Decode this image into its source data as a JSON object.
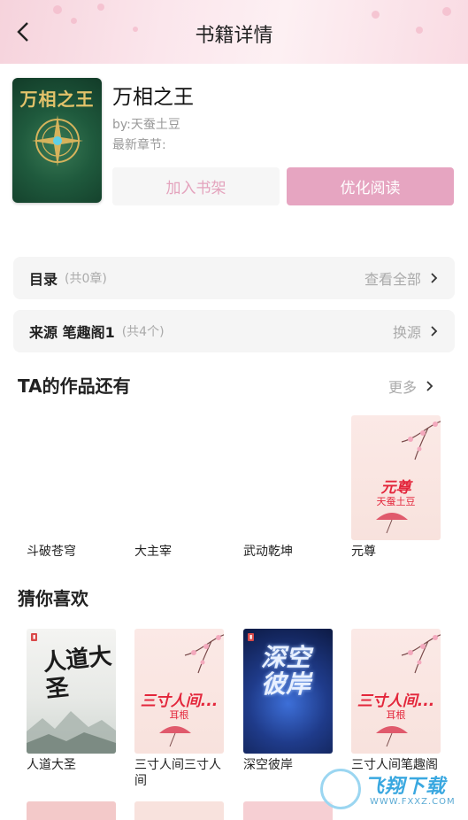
{
  "header": {
    "title": "书籍详情"
  },
  "book": {
    "title": "万相之王",
    "author": "by:天蚕土豆",
    "latest": "最新章节:",
    "cover_title": "万相之王",
    "shelf_label": "加入书架",
    "read_label": "优化阅读"
  },
  "catalog": {
    "label": "目录",
    "count": "(共0章)",
    "action": "查看全部"
  },
  "source": {
    "label": "来源 笔趣阁1",
    "count": "(共4个)",
    "action": "换源"
  },
  "author_works": {
    "title": "TA的作品还有",
    "more": "更多",
    "items": [
      {
        "name": "斗破苍穹"
      },
      {
        "name": "大主宰"
      },
      {
        "name": "武动乾坤"
      },
      {
        "name": "元尊",
        "cover_title": "元尊",
        "cover_sub": "天蚕土豆"
      }
    ]
  },
  "recommend": {
    "title": "猜你喜欢",
    "items": [
      {
        "name": "人道大圣",
        "cover_title": "人道大圣"
      },
      {
        "name": "三寸人间三寸人间",
        "cover_title": "三寸人间...",
        "cover_sub": "耳根"
      },
      {
        "name": "深空彼岸",
        "cover_title": "深空彼岸"
      },
      {
        "name": "三寸人间笔趣阁",
        "cover_title": "三寸人间...",
        "cover_sub": "耳根"
      }
    ]
  },
  "watermark": {
    "text": "飞翔下载",
    "url": "WWW.FXXZ.COM"
  },
  "colors": {
    "accent": "#e6a5c1",
    "accent_text": "#e4a3bd",
    "card_bg": "#f5f5f5",
    "muted": "#aaaaaa"
  }
}
